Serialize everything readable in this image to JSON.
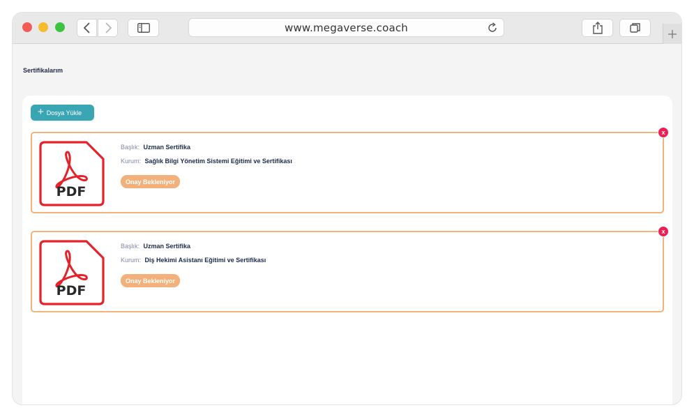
{
  "browser": {
    "url": "www.megaverse.coach"
  },
  "page": {
    "title": "Sertifikalarım",
    "upload_button": {
      "plus": "+",
      "label": "Dosya Yükle"
    }
  },
  "certificates": [
    {
      "title_label": "Başlık:",
      "title_value": "Uzman Sertifika",
      "org_label": "Kurum:",
      "org_value": "Sağlık Bilgi Yönetim Sistemi Eğitimi ve Sertifikası",
      "status": "Onay Bekleniyor",
      "file_type": "PDF",
      "close": "x"
    },
    {
      "title_label": "Başlık:",
      "title_value": "Uzman Sertifika",
      "org_label": "Kurum:",
      "org_value": "Diş Hekimi Asistanı Eğitimi ve Sertifikası",
      "status": "Onay Bekleniyor",
      "file_type": "PDF",
      "close": "x"
    }
  ],
  "colors": {
    "accent": "#3aa6b4",
    "card_border": "#f2b37a",
    "badge": "#f3b07a",
    "close": "#ee1f54",
    "pdf_red": "#e4222a"
  },
  "icons": [
    "chevron-left-icon",
    "chevron-right-icon",
    "sidebar-icon",
    "reload-icon",
    "share-icon",
    "tabs-icon",
    "plus-icon",
    "pdf-file-icon",
    "close-icon"
  ]
}
